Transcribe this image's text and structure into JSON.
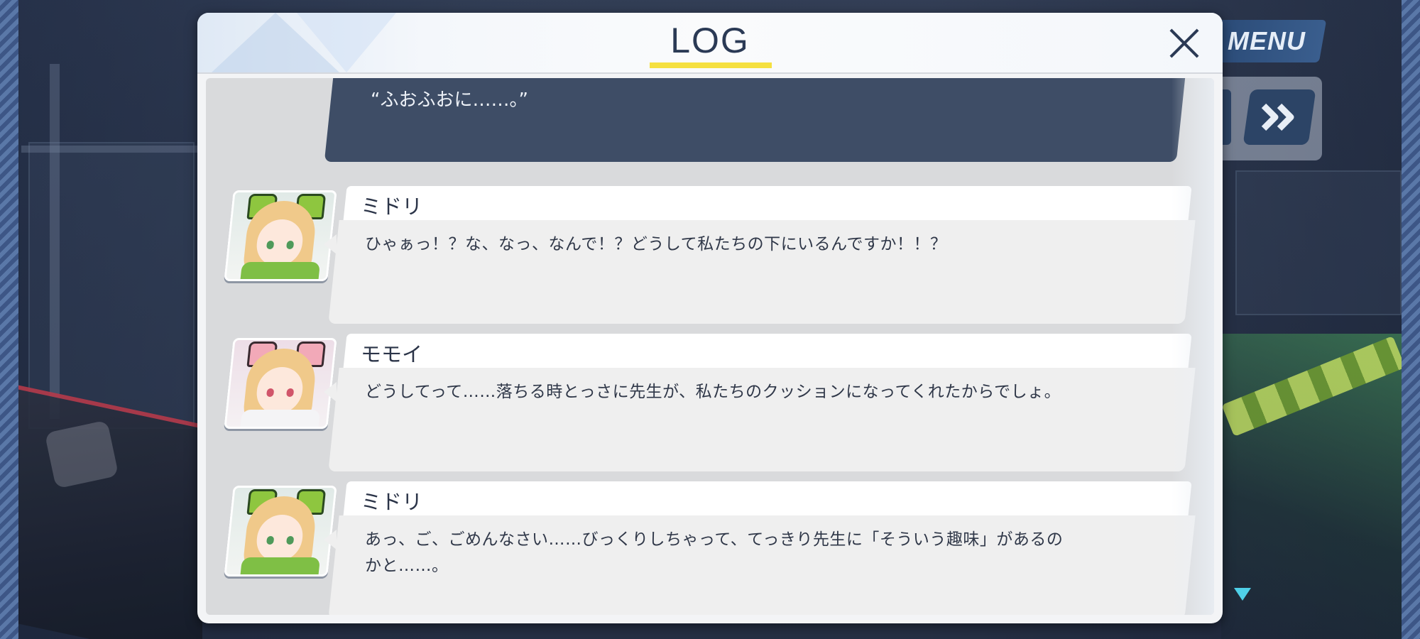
{
  "hud": {
    "menu_label": "MENU",
    "fast_forward_icon": "double-chevron-right-icon"
  },
  "log": {
    "title": "LOG",
    "close_icon": "close-icon",
    "narration_partial": "“ふおふおに……。”",
    "entries": [
      {
        "speaker": "ミドリ",
        "character": "midori",
        "text": "ひゃぁっ！？な、なっ、なんで！？どうして私たちの下にいるんですか！！？"
      },
      {
        "speaker": "モモイ",
        "character": "momoi",
        "text": "どうしてって……落ちる時とっさに先生が、私たちのクッションになってくれたからでしょ。"
      },
      {
        "speaker": "ミドリ",
        "character": "midori",
        "text_line1": "あっ、ご、ごめんなさい……びっくりしちゃって、てっきり先生に「そういう趣味」があるの",
        "text_line2": "かと……。"
      }
    ]
  },
  "colors": {
    "header_title": "#2b3a55",
    "title_underline": "#f5e040",
    "narration_bubble": "#3e4d66",
    "speech_bubble": "#efefef",
    "menu_button": "#2a4a76"
  }
}
